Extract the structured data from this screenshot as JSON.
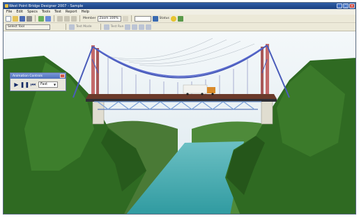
{
  "window": {
    "title": "West Point Bridge Designer 2007 - Sample"
  },
  "menu": [
    "File",
    "Edit",
    "Specs",
    "Tools",
    "Test",
    "Report",
    "Help"
  ],
  "toolbar1": {
    "zoom_label": "Member",
    "zoom_value": "Zoom 100%",
    "view_label": "Status"
  },
  "toolbar2": {
    "tool_label": "Select Tool",
    "design_label": "Test Mode",
    "cost_label": "Test Run"
  },
  "animation_controls": {
    "title": "Animation Controls",
    "speed": "Fast"
  },
  "colors": {
    "sky": "#e4eef4",
    "water": "#3fa5a6",
    "hills": "#2f6a22",
    "cable": "#4a5cba",
    "towers": "#c46a6a",
    "truck": "#d98a2a"
  }
}
